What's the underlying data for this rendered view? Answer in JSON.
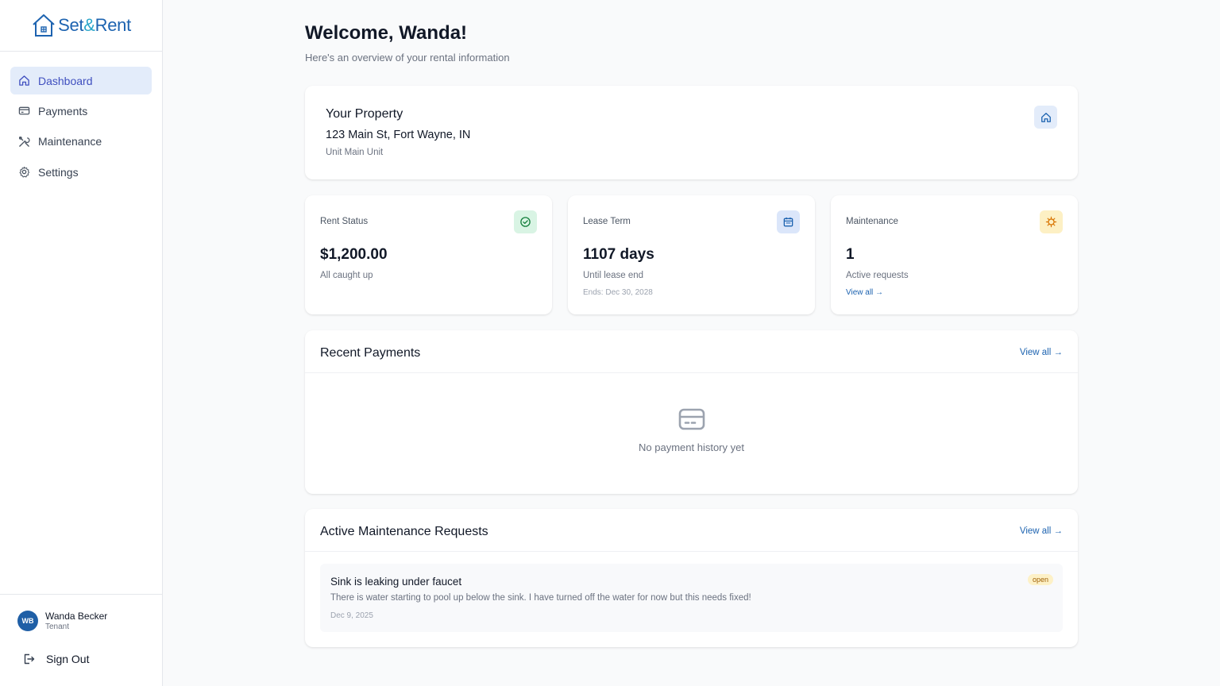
{
  "brand": {
    "name_part1": "Set",
    "name_amp": "&",
    "name_part2": "Rent"
  },
  "sidebar": {
    "items": [
      {
        "label": "Dashboard",
        "icon": "home-icon",
        "active": true
      },
      {
        "label": "Payments",
        "icon": "credit-card-icon",
        "active": false
      },
      {
        "label": "Maintenance",
        "icon": "tools-icon",
        "active": false
      },
      {
        "label": "Settings",
        "icon": "gear-icon",
        "active": false
      }
    ],
    "user": {
      "initials": "WB",
      "name": "Wanda Becker",
      "role": "Tenant"
    },
    "signout_label": "Sign Out"
  },
  "header": {
    "title": "Welcome, Wanda!",
    "subtitle": "Here's an overview of your rental information"
  },
  "property": {
    "title": "Your Property",
    "address": "123 Main St, Fort Wayne, IN",
    "unit": "Unit Main Unit"
  },
  "stats": {
    "rent": {
      "label": "Rent Status",
      "value": "$1,200.00",
      "desc": "All caught up",
      "icon": "check-circle-icon",
      "color": "#16a34a"
    },
    "lease": {
      "label": "Lease Term",
      "value": "1107 days",
      "desc": "Until lease end",
      "extra": "Ends: Dec 30, 2028",
      "icon": "calendar-icon",
      "color": "#1d63b0"
    },
    "maintenance": {
      "label": "Maintenance",
      "value": "1",
      "desc": "Active requests",
      "link": "View all →",
      "icon": "gear-alert-icon",
      "color": "#d97706"
    }
  },
  "payments": {
    "title": "Recent Payments",
    "view_all": "View all →",
    "empty_text": "No payment history yet"
  },
  "maintenance_requests": {
    "title": "Active Maintenance Requests",
    "view_all": "View all →",
    "items": [
      {
        "title": "Sink is leaking under faucet",
        "description": "There is water starting to pool up below the sink. I have turned off the water for now but this needs fixed!",
        "date": "Dec 9, 2025",
        "status": "open"
      }
    ]
  },
  "colors": {
    "accent": "#1d63b0",
    "active_nav_bg": "#e3ecfa",
    "active_nav_text": "#3f4fbf",
    "status_open_bg": "#fdf1c7"
  }
}
